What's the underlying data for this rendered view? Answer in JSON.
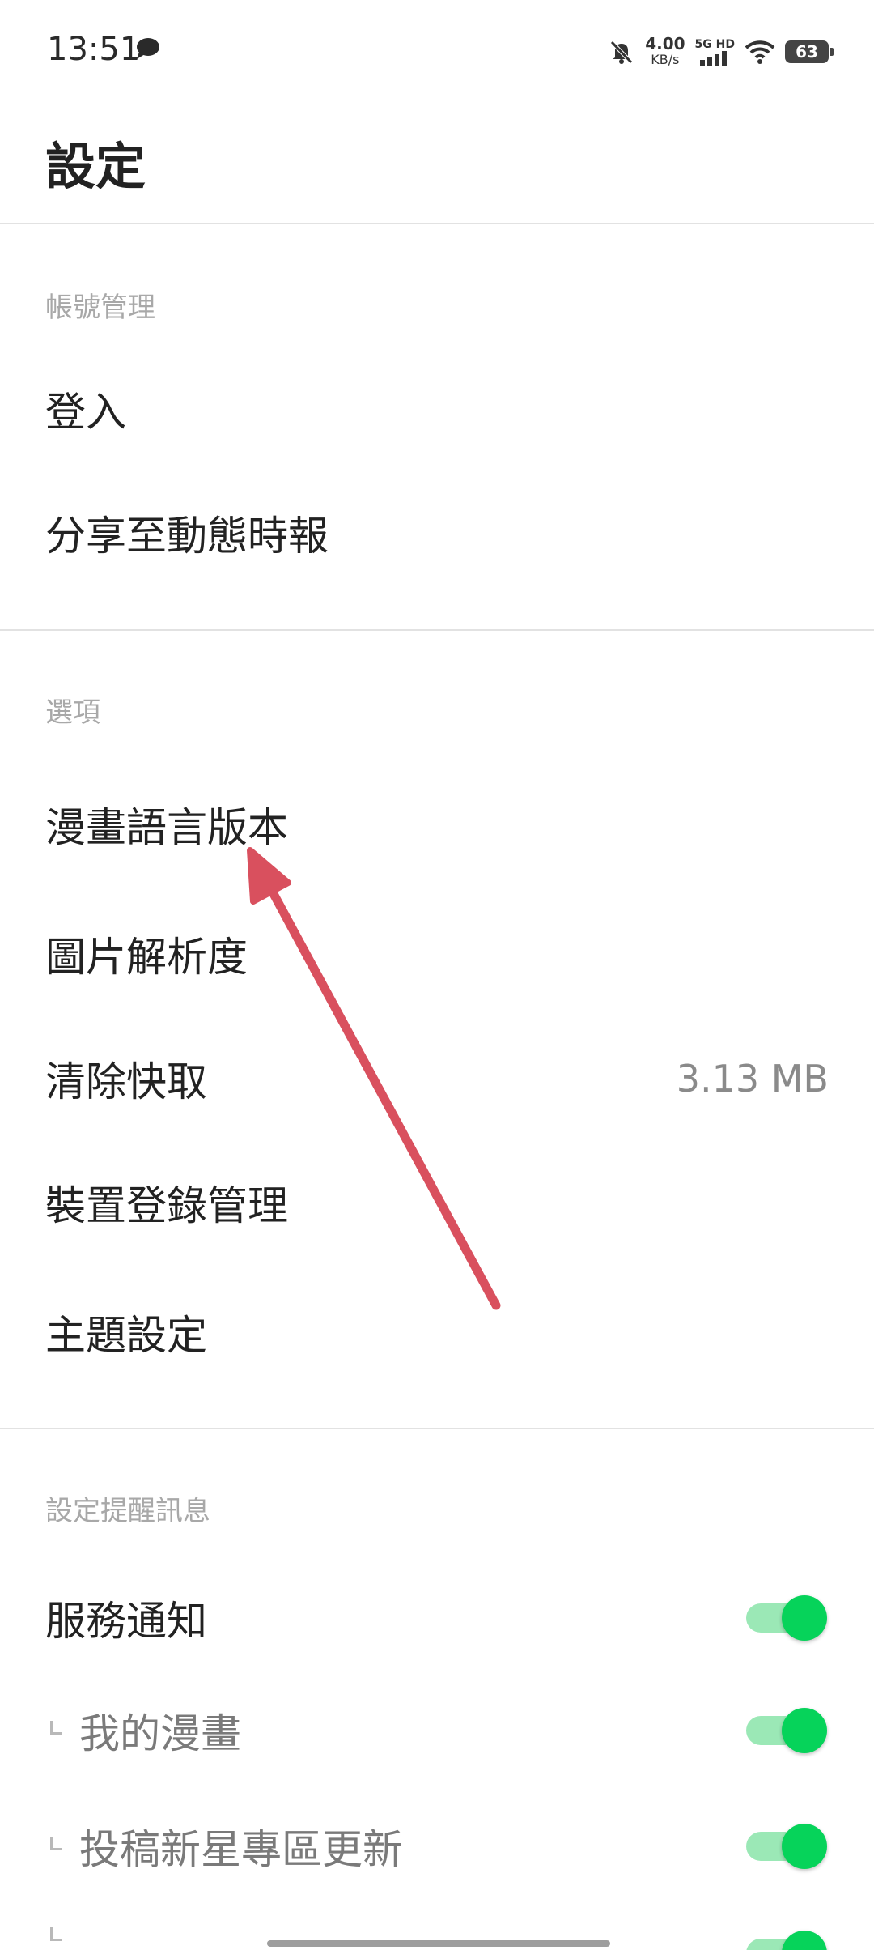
{
  "status_bar": {
    "time": "13:51",
    "net_speed": "4.00",
    "net_speed_unit": "KB/s",
    "signal_label": "5G HD",
    "battery": "63"
  },
  "header": {
    "title": "設定"
  },
  "sections": {
    "account": {
      "title": "帳號管理",
      "items": [
        "登入",
        "分享至動態時報"
      ]
    },
    "options": {
      "title": "選項",
      "items": [
        "漫畫語言版本",
        "圖片解析度",
        "清除快取",
        "裝置登錄管理",
        "主題設定"
      ],
      "cache_size": "3.13 MB"
    },
    "notifications": {
      "title": "設定提醒訊息",
      "items": [
        {
          "label": "服務通知",
          "on": true
        },
        {
          "label": "我的漫畫",
          "on": true
        },
        {
          "label": "投稿新星專區更新",
          "on": true
        },
        {
          "label": "",
          "on": true
        }
      ]
    }
  },
  "colors": {
    "toggle_on": "#06d35a",
    "toggle_track": "#9be8b6",
    "annotation_arrow": "#d9505e"
  },
  "icons": [
    "chat-bubble-icon",
    "bell-muted-icon",
    "signal-bars-icon",
    "wifi-icon",
    "battery-icon"
  ]
}
